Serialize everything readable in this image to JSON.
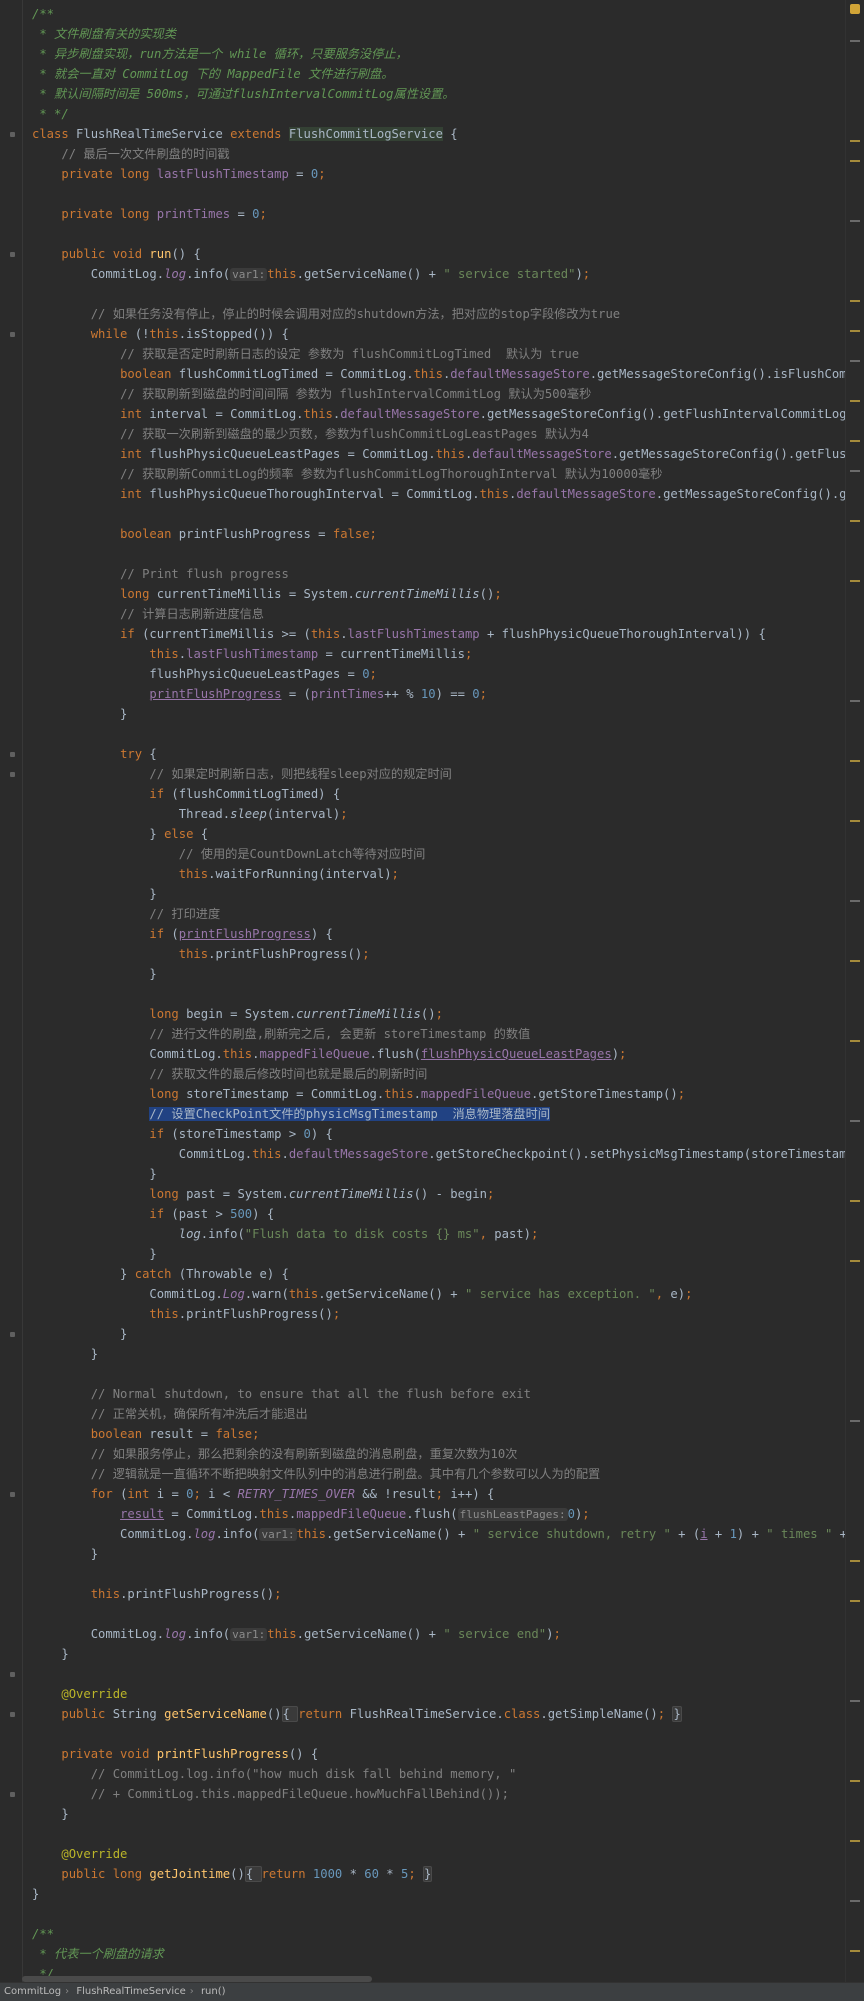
{
  "theme": {
    "background": "#2b2b2b",
    "keyword": "#cc7832",
    "string": "#6a8759",
    "comment": "#808080",
    "doc_comment": "#629755",
    "number": "#6897bb",
    "field": "#9876aa",
    "method_decl": "#ffc66d",
    "annotation": "#bbb529",
    "selection": "#214283"
  },
  "breadcrumb": {
    "items": [
      "CommitLog",
      "FlushRealTimeService",
      "run()"
    ],
    "separator": "›"
  },
  "code": [
    [
      [
        "doc",
        "/**"
      ]
    ],
    [
      [
        "doc",
        " * 文件刷盘有关的实现类"
      ]
    ],
    [
      [
        "doc",
        " * 异步刷盘实现，run方法是一个 while 循环，只要服务没停止，"
      ]
    ],
    [
      [
        "doc",
        " * 就会一直对 CommitLog 下的 MappedFile 文件进行刷盘。"
      ]
    ],
    [
      [
        "doc",
        " * 默认间隔时间是 500ms，可通过flushIntervalCommitLog属性设置。"
      ]
    ],
    [
      [
        "doc",
        " * */"
      ]
    ],
    [
      [
        "kw",
        "class "
      ],
      [
        "p",
        "FlushRealTimeService "
      ],
      [
        "kw",
        "extends "
      ],
      [
        "clshl",
        "FlushCommitLogService"
      ],
      [
        "p",
        " {"
      ]
    ],
    [
      [
        "p",
        "    "
      ],
      [
        "cm",
        "// 最后一次文件刷盘的时间戳"
      ]
    ],
    [
      [
        "p",
        "    "
      ],
      [
        "kw",
        "private long "
      ],
      [
        "fld",
        "lastFlushTimestamp"
      ],
      [
        "p",
        " = "
      ],
      [
        "num",
        "0"
      ],
      [
        "kw",
        ";"
      ]
    ],
    [],
    [
      [
        "p",
        "    "
      ],
      [
        "kw",
        "private long "
      ],
      [
        "fld",
        "printTimes"
      ],
      [
        "p",
        " = "
      ],
      [
        "num",
        "0"
      ],
      [
        "kw",
        ";"
      ]
    ],
    [],
    [
      [
        "p",
        "    "
      ],
      [
        "kw",
        "public void "
      ],
      [
        "fn",
        "run"
      ],
      [
        "p",
        "() {"
      ]
    ],
    [
      [
        "p",
        "        CommitLog."
      ],
      [
        "sfld",
        "log"
      ],
      [
        "p",
        ".info("
      ],
      [
        "hint",
        "var1:"
      ],
      [
        "kw",
        "this"
      ],
      [
        "p",
        ".getServiceName() + "
      ],
      [
        "str",
        "\" service started\""
      ],
      [
        "p",
        ")"
      ],
      [
        "kw",
        ";"
      ]
    ],
    [],
    [
      [
        "p",
        "        "
      ],
      [
        "cm",
        "// 如果任务没有停止，停止的时候会调用对应的shutdown方法，把对应的stop字段修改为true"
      ]
    ],
    [
      [
        "p",
        "        "
      ],
      [
        "kw",
        "while "
      ],
      [
        "p",
        "(!"
      ],
      [
        "kw",
        "this"
      ],
      [
        "p",
        ".isStopped()) {"
      ]
    ],
    [
      [
        "p",
        "            "
      ],
      [
        "cm",
        "// 获取是否定时刷新日志的设定 参数为 flushCommitLogTimed  默认为 true"
      ]
    ],
    [
      [
        "p",
        "            "
      ],
      [
        "kw",
        "boolean "
      ],
      [
        "p",
        "flushCommitLogTimed = CommitLog."
      ],
      [
        "kw",
        "this"
      ],
      [
        "p",
        "."
      ],
      [
        "fld",
        "defaultMessageStore"
      ],
      [
        "p",
        ".getMessageStoreConfig().isFlushComm"
      ]
    ],
    [
      [
        "p",
        "            "
      ],
      [
        "cm",
        "// 获取刷新到磁盘的时间间隔 参数为 flushIntervalCommitLog 默认为500毫秒"
      ]
    ],
    [
      [
        "p",
        "            "
      ],
      [
        "kw",
        "int "
      ],
      [
        "p",
        "interval = CommitLog."
      ],
      [
        "kw",
        "this"
      ],
      [
        "p",
        "."
      ],
      [
        "fld",
        "defaultMessageStore"
      ],
      [
        "p",
        ".getMessageStoreConfig().getFlushIntervalCommitLog("
      ]
    ],
    [
      [
        "p",
        "            "
      ],
      [
        "cm",
        "// 获取一次刷新到磁盘的最少页数，参数为flushCommitLogLeastPages 默认为4"
      ]
    ],
    [
      [
        "p",
        "            "
      ],
      [
        "kw",
        "int "
      ],
      [
        "p",
        "flushPhysicQueueLeastPages = CommitLog."
      ],
      [
        "kw",
        "this"
      ],
      [
        "p",
        "."
      ],
      [
        "fld",
        "defaultMessageStore"
      ],
      [
        "p",
        ".getMessageStoreConfig().getFlush"
      ]
    ],
    [
      [
        "p",
        "            "
      ],
      [
        "cm",
        "// 获取刷新CommitLog的频率 参数为flushCommitLogThoroughInterval 默认为10000毫秒"
      ]
    ],
    [
      [
        "p",
        "            "
      ],
      [
        "kw",
        "int "
      ],
      [
        "p",
        "flushPhysicQueueThoroughInterval = CommitLog."
      ],
      [
        "kw",
        "this"
      ],
      [
        "p",
        "."
      ],
      [
        "fld",
        "defaultMessageStore"
      ],
      [
        "p",
        ".getMessageStoreConfig().ge"
      ]
    ],
    [],
    [
      [
        "p",
        "            "
      ],
      [
        "kw",
        "boolean "
      ],
      [
        "p",
        "printFlushProgress = "
      ],
      [
        "kw",
        "false;"
      ]
    ],
    [],
    [
      [
        "p",
        "            "
      ],
      [
        "cm",
        "// Print flush progress"
      ]
    ],
    [
      [
        "p",
        "            "
      ],
      [
        "kw",
        "long "
      ],
      [
        "p",
        "currentTimeMillis = System."
      ],
      [
        "si",
        "currentTimeMillis"
      ],
      [
        "p",
        "()"
      ],
      [
        "kw",
        ";"
      ]
    ],
    [
      [
        "p",
        "            "
      ],
      [
        "cm",
        "// 计算日志刷新进度信息"
      ]
    ],
    [
      [
        "p",
        "            "
      ],
      [
        "kw",
        "if "
      ],
      [
        "p",
        "(currentTimeMillis >= ("
      ],
      [
        "kw",
        "this"
      ],
      [
        "p",
        "."
      ],
      [
        "fld",
        "lastFlushTimestamp"
      ],
      [
        "p",
        " + flushPhysicQueueThoroughInterval)) {"
      ]
    ],
    [
      [
        "p",
        "                "
      ],
      [
        "kw",
        "this"
      ],
      [
        "p",
        "."
      ],
      [
        "fld",
        "lastFlushTimestamp"
      ],
      [
        "p",
        " = currentTimeMillis"
      ],
      [
        "kw",
        ";"
      ]
    ],
    [
      [
        "p",
        "                flushPhysicQueueLeastPages = "
      ],
      [
        "num",
        "0"
      ],
      [
        "kw",
        ";"
      ]
    ],
    [
      [
        "p",
        "                "
      ],
      [
        "ul",
        "printFlushProgress"
      ],
      [
        "p",
        " = ("
      ],
      [
        "fld",
        "printTimes"
      ],
      [
        "p",
        "++ % "
      ],
      [
        "num",
        "10"
      ],
      [
        "p",
        ") == "
      ],
      [
        "num",
        "0"
      ],
      [
        "kw",
        ";"
      ]
    ],
    [
      [
        "p",
        "            }"
      ]
    ],
    [],
    [
      [
        "p",
        "            "
      ],
      [
        "kw",
        "try "
      ],
      [
        "p",
        "{"
      ]
    ],
    [
      [
        "p",
        "                "
      ],
      [
        "cm",
        "// 如果定时刷新日志，则把线程sleep对应的规定时间"
      ]
    ],
    [
      [
        "p",
        "                "
      ],
      [
        "kw",
        "if "
      ],
      [
        "p",
        "(flushCommitLogTimed) {"
      ]
    ],
    [
      [
        "p",
        "                    Thread."
      ],
      [
        "si",
        "sleep"
      ],
      [
        "p",
        "(interval)"
      ],
      [
        "kw",
        ";"
      ]
    ],
    [
      [
        "p",
        "                } "
      ],
      [
        "kw",
        "else "
      ],
      [
        "p",
        "{"
      ]
    ],
    [
      [
        "p",
        "                    "
      ],
      [
        "cm",
        "// 使用的是CountDownLatch等待对应时间"
      ]
    ],
    [
      [
        "p",
        "                    "
      ],
      [
        "kw",
        "this"
      ],
      [
        "p",
        ".waitForRunning(interval)"
      ],
      [
        "kw",
        ";"
      ]
    ],
    [
      [
        "p",
        "                }"
      ]
    ],
    [
      [
        "p",
        "                "
      ],
      [
        "cm",
        "// 打印进度"
      ]
    ],
    [
      [
        "p",
        "                "
      ],
      [
        "kw",
        "if "
      ],
      [
        "p",
        "("
      ],
      [
        "ul",
        "printFlushProgress"
      ],
      [
        "p",
        ") {"
      ]
    ],
    [
      [
        "p",
        "                    "
      ],
      [
        "kw",
        "this"
      ],
      [
        "p",
        ".printFlushProgress()"
      ],
      [
        "kw",
        ";"
      ]
    ],
    [
      [
        "p",
        "                }"
      ]
    ],
    [],
    [
      [
        "p",
        "                "
      ],
      [
        "kw",
        "long "
      ],
      [
        "p",
        "begin = System."
      ],
      [
        "si",
        "currentTimeMillis"
      ],
      [
        "p",
        "()"
      ],
      [
        "kw",
        ";"
      ]
    ],
    [
      [
        "p",
        "                "
      ],
      [
        "cm",
        "// 进行文件的刷盘,刷新完之后, 会更新 storeTimestamp 的数值"
      ]
    ],
    [
      [
        "p",
        "                CommitLog."
      ],
      [
        "kw",
        "this"
      ],
      [
        "p",
        "."
      ],
      [
        "fld",
        "mappedFileQueue"
      ],
      [
        "p",
        ".flush("
      ],
      [
        "ul",
        "flushPhysicQueueLeastPages"
      ],
      [
        "p",
        ")"
      ],
      [
        "kw",
        ";"
      ]
    ],
    [
      [
        "p",
        "                "
      ],
      [
        "cm",
        "// 获取文件的最后修改时间也就是最后的刷新时间"
      ]
    ],
    [
      [
        "p",
        "                "
      ],
      [
        "kw",
        "long "
      ],
      [
        "p",
        "storeTimestamp = CommitLog."
      ],
      [
        "kw",
        "this"
      ],
      [
        "p",
        "."
      ],
      [
        "fld",
        "mappedFileQueue"
      ],
      [
        "p",
        ".getStoreTimestamp()"
      ],
      [
        "kw",
        ";"
      ]
    ],
    [
      [
        "p",
        "                "
      ],
      [
        "sel",
        "// 设置CheckPoint文件的physicMsgTimestamp  消息物理落盘时间"
      ]
    ],
    [
      [
        "p",
        "                "
      ],
      [
        "kw",
        "if "
      ],
      [
        "p",
        "(storeTimestamp > "
      ],
      [
        "num",
        "0"
      ],
      [
        "p",
        ") {"
      ]
    ],
    [
      [
        "p",
        "                    CommitLog."
      ],
      [
        "kw",
        "this"
      ],
      [
        "p",
        "."
      ],
      [
        "fld",
        "defaultMessageStore"
      ],
      [
        "p",
        ".getStoreCheckpoint().setPhysicMsgTimestamp(storeTimestamp"
      ]
    ],
    [
      [
        "p",
        "                }"
      ]
    ],
    [
      [
        "p",
        "                "
      ],
      [
        "kw",
        "long "
      ],
      [
        "p",
        "past = System."
      ],
      [
        "si",
        "currentTimeMillis"
      ],
      [
        "p",
        "() - begin"
      ],
      [
        "kw",
        ";"
      ]
    ],
    [
      [
        "p",
        "                "
      ],
      [
        "kw",
        "if "
      ],
      [
        "p",
        "(past > "
      ],
      [
        "num",
        "500"
      ],
      [
        "p",
        ") {"
      ]
    ],
    [
      [
        "p",
        "                    "
      ],
      [
        "si",
        "log"
      ],
      [
        "p",
        ".info("
      ],
      [
        "str",
        "\"Flush data to disk costs {} ms\""
      ],
      [
        "kw",
        ", "
      ],
      [
        "p",
        "past)"
      ],
      [
        "kw",
        ";"
      ]
    ],
    [
      [
        "p",
        "                }"
      ]
    ],
    [
      [
        "p",
        "            } "
      ],
      [
        "kw",
        "catch "
      ],
      [
        "p",
        "(Throwable e) {"
      ]
    ],
    [
      [
        "p",
        "                CommitLog."
      ],
      [
        "sfld",
        "Log"
      ],
      [
        "p",
        ".warn("
      ],
      [
        "kw",
        "this"
      ],
      [
        "p",
        ".getServiceName() + "
      ],
      [
        "str",
        "\" service has exception. \""
      ],
      [
        "kw",
        ", "
      ],
      [
        "p",
        "e)"
      ],
      [
        "kw",
        ";"
      ]
    ],
    [
      [
        "p",
        "                "
      ],
      [
        "kw",
        "this"
      ],
      [
        "p",
        ".printFlushProgress()"
      ],
      [
        "kw",
        ";"
      ]
    ],
    [
      [
        "p",
        "            }"
      ]
    ],
    [
      [
        "p",
        "        }"
      ]
    ],
    [],
    [
      [
        "p",
        "        "
      ],
      [
        "cm",
        "// Normal shutdown, to ensure that all the flush before exit"
      ]
    ],
    [
      [
        "p",
        "        "
      ],
      [
        "cm",
        "// 正常关机，确保所有冲洗后才能退出"
      ]
    ],
    [
      [
        "p",
        "        "
      ],
      [
        "kw",
        "boolean "
      ],
      [
        "p",
        "result = "
      ],
      [
        "kw",
        "false;"
      ]
    ],
    [
      [
        "p",
        "        "
      ],
      [
        "cm",
        "// 如果服务停止，那么把剩余的没有刷新到磁盘的消息刷盘，重复次数为10次"
      ]
    ],
    [
      [
        "p",
        "        "
      ],
      [
        "cm",
        "// 逻辑就是一直循环不断把映射文件队列中的消息进行刷盘。其中有几个参数可以人为的配置"
      ]
    ],
    [
      [
        "p",
        "        "
      ],
      [
        "kw",
        "for "
      ],
      [
        "p",
        "("
      ],
      [
        "kw",
        "int "
      ],
      [
        "p",
        "i = "
      ],
      [
        "num",
        "0"
      ],
      [
        "kw",
        "; "
      ],
      [
        "p",
        "i < "
      ],
      [
        "sfld",
        "RETRY_TIMES_OVER"
      ],
      [
        "p",
        " && !result"
      ],
      [
        "kw",
        "; "
      ],
      [
        "p",
        "i++) {"
      ]
    ],
    [
      [
        "p",
        "            "
      ],
      [
        "ul",
        "result"
      ],
      [
        "p",
        " = CommitLog."
      ],
      [
        "kw",
        "this"
      ],
      [
        "p",
        "."
      ],
      [
        "fld",
        "mappedFileQueue"
      ],
      [
        "p",
        ".flush("
      ],
      [
        "hint",
        "flushLeastPages:"
      ],
      [
        "num",
        "0"
      ],
      [
        "p",
        ")"
      ],
      [
        "kw",
        ";"
      ]
    ],
    [
      [
        "p",
        "            CommitLog."
      ],
      [
        "sfld",
        "log"
      ],
      [
        "p",
        ".info("
      ],
      [
        "hint",
        "var1:"
      ],
      [
        "kw",
        "this"
      ],
      [
        "p",
        ".getServiceName() + "
      ],
      [
        "str",
        "\" service shutdown, retry \""
      ],
      [
        "p",
        " + ("
      ],
      [
        "ul",
        "i"
      ],
      [
        "p",
        " + "
      ],
      [
        "num",
        "1"
      ],
      [
        "p",
        ") + "
      ],
      [
        "str",
        "\" times \""
      ],
      [
        "p",
        " +"
      ]
    ],
    [
      [
        "p",
        "        }"
      ]
    ],
    [],
    [
      [
        "p",
        "        "
      ],
      [
        "kw",
        "this"
      ],
      [
        "p",
        ".printFlushProgress()"
      ],
      [
        "kw",
        ";"
      ]
    ],
    [],
    [
      [
        "p",
        "        CommitLog."
      ],
      [
        "sfld",
        "log"
      ],
      [
        "p",
        ".info("
      ],
      [
        "hint",
        "var1:"
      ],
      [
        "kw",
        "this"
      ],
      [
        "p",
        ".getServiceName() + "
      ],
      [
        "str",
        "\" service end\""
      ],
      [
        "p",
        ")"
      ],
      [
        "kw",
        ";"
      ]
    ],
    [
      [
        "p",
        "    }"
      ]
    ],
    [],
    [
      [
        "p",
        "    "
      ],
      [
        "ann",
        "@Override"
      ]
    ],
    [
      [
        "p",
        "    "
      ],
      [
        "kw",
        "public "
      ],
      [
        "p",
        "String "
      ],
      [
        "fn",
        "getServiceName"
      ],
      [
        "p",
        "()"
      ],
      [
        "fold",
        "{ "
      ],
      [
        "kw",
        "return "
      ],
      [
        "p",
        "FlushRealTimeService."
      ],
      [
        "kw",
        "class"
      ],
      [
        "p",
        ".getSimpleName()"
      ],
      [
        "kw",
        "; "
      ],
      [
        "fold",
        "}"
      ]
    ],
    [],
    [
      [
        "p",
        "    "
      ],
      [
        "kw",
        "private void "
      ],
      [
        "fn",
        "printFlushProgress"
      ],
      [
        "p",
        "() {"
      ]
    ],
    [
      [
        "p",
        "        "
      ],
      [
        "cm",
        "// CommitLog.log.info(\"how much disk fall behind memory, \""
      ]
    ],
    [
      [
        "p",
        "        "
      ],
      [
        "cm",
        "// + CommitLog.this.mappedFileQueue.howMuchFallBehind());"
      ]
    ],
    [
      [
        "p",
        "    }"
      ]
    ],
    [],
    [
      [
        "p",
        "    "
      ],
      [
        "ann",
        "@Override"
      ]
    ],
    [
      [
        "p",
        "    "
      ],
      [
        "kw",
        "public long "
      ],
      [
        "fn",
        "getJointime"
      ],
      [
        "p",
        "()"
      ],
      [
        "fold",
        "{ "
      ],
      [
        "kw",
        "return "
      ],
      [
        "num",
        "1000"
      ],
      [
        "p",
        " * "
      ],
      [
        "num",
        "60"
      ],
      [
        "p",
        " * "
      ],
      [
        "num",
        "5"
      ],
      [
        "kw",
        "; "
      ],
      [
        "fold",
        "}"
      ]
    ],
    [
      [
        "p",
        "}"
      ]
    ],
    [],
    [
      [
        "doc",
        "/**"
      ]
    ],
    [
      [
        "doc",
        " * 代表一个刷盘的请求"
      ]
    ],
    [
      [
        "doc",
        " */"
      ]
    ]
  ]
}
